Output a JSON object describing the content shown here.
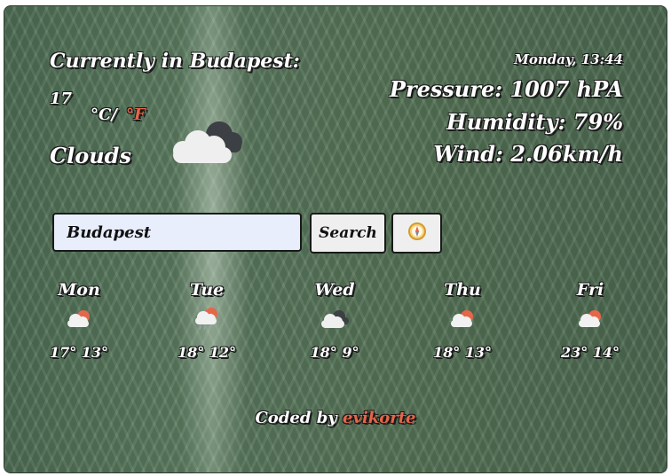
{
  "current": {
    "location_label": "Currently in Budapest:",
    "temperature": "17",
    "unit_celsius": "°C/",
    "unit_fahrenheit": "°F",
    "description": "Clouds",
    "icon": "clouds-icon"
  },
  "details": {
    "date": "Monday, 13:44",
    "pressure": "Pressure: 1007 hPA",
    "humidity": "Humidity: 79%",
    "wind": "Wind: 2.06km/h"
  },
  "search": {
    "value": "Budapest",
    "placeholder": "",
    "button_label": "Search",
    "location_icon": "compass-icon"
  },
  "forecast": [
    {
      "day": "Mon",
      "icon": "partly-cloudy-icon",
      "temps": "17° 13°"
    },
    {
      "day": "Tue",
      "icon": "rain-cloud-sun-icon",
      "temps": "18° 12°"
    },
    {
      "day": "Wed",
      "icon": "clouds-icon",
      "temps": "18° 9°"
    },
    {
      "day": "Thu",
      "icon": "partly-cloudy-icon",
      "temps": "18° 13°"
    },
    {
      "day": "Fri",
      "icon": "partly-cloudy-icon",
      "temps": "23° 14°"
    }
  ],
  "footer": {
    "prefix": "Coded by ",
    "author": "evikorte"
  },
  "colors": {
    "accent": "#e5674a",
    "leaf_green": "#5b7a5f"
  }
}
